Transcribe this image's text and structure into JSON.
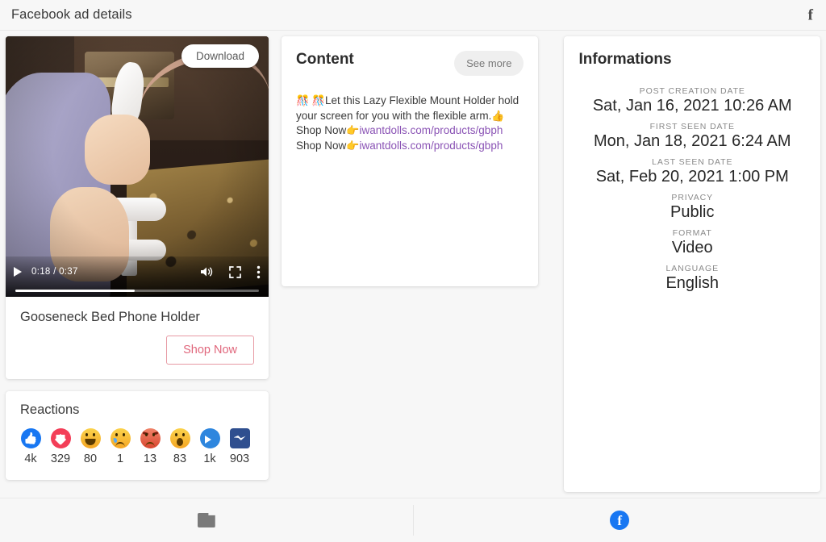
{
  "header": {
    "title": "Facebook ad details",
    "fb_glyph": "f",
    "fb_icon_name": "facebook-icon"
  },
  "video": {
    "download_label": "Download",
    "current_time": "0:18",
    "total_time": "0:37",
    "time_display": "0:18 / 0:37",
    "progress_percent": 49,
    "product_title": "Gooseneck Bed Phone Holder",
    "cta_label": "Shop Now",
    "cta_border_color": "#e79aa4",
    "cta_text_color": "#e0677c"
  },
  "reactions": {
    "title": "Reactions",
    "items": [
      {
        "name": "like",
        "count": "4k",
        "color": "#1877f2"
      },
      {
        "name": "love",
        "count": "329",
        "color": "#f33e58"
      },
      {
        "name": "haha",
        "count": "80",
        "color": "#f7b928"
      },
      {
        "name": "sad",
        "count": "1",
        "color": "#f7b928"
      },
      {
        "name": "angry",
        "count": "13",
        "color": "#e0452c"
      },
      {
        "name": "wow",
        "count": "83",
        "color": "#f7b928"
      },
      {
        "name": "share",
        "count": "1k",
        "color": "#2e86de"
      },
      {
        "name": "messenger",
        "count": "903",
        "color": "#2f4f8f"
      }
    ]
  },
  "content": {
    "title": "Content",
    "see_more_label": "See more",
    "line1_emoji": "🎊 🎊",
    "line1_text": "Let this Lazy Flexible Mount Holder hold your screen for you with the flexible arm.",
    "line1_end_emoji": "👍",
    "shop_now_text": "Shop Now",
    "pointer_emoji": "👉",
    "link_url": "iwantdolls.com/products/gbph",
    "link_color": "#8a53b5"
  },
  "informations": {
    "title": "Informations",
    "fields": [
      {
        "label": "POST CREATION DATE",
        "value": "Sat, Jan 16, 2021 10:26 AM"
      },
      {
        "label": "FIRST SEEN DATE",
        "value": "Mon, Jan 18, 2021 6:24 AM"
      },
      {
        "label": "LAST SEEN DATE",
        "value": "Sat, Feb 20, 2021 1:00 PM"
      },
      {
        "label": "PRIVACY",
        "value": "Public"
      },
      {
        "label": "FORMAT",
        "value": "Video"
      },
      {
        "label": "LANGUAGE",
        "value": "English"
      }
    ]
  },
  "bottombar": {
    "folder_icon_name": "folder-icon",
    "facebook_icon_name": "facebook-icon"
  }
}
